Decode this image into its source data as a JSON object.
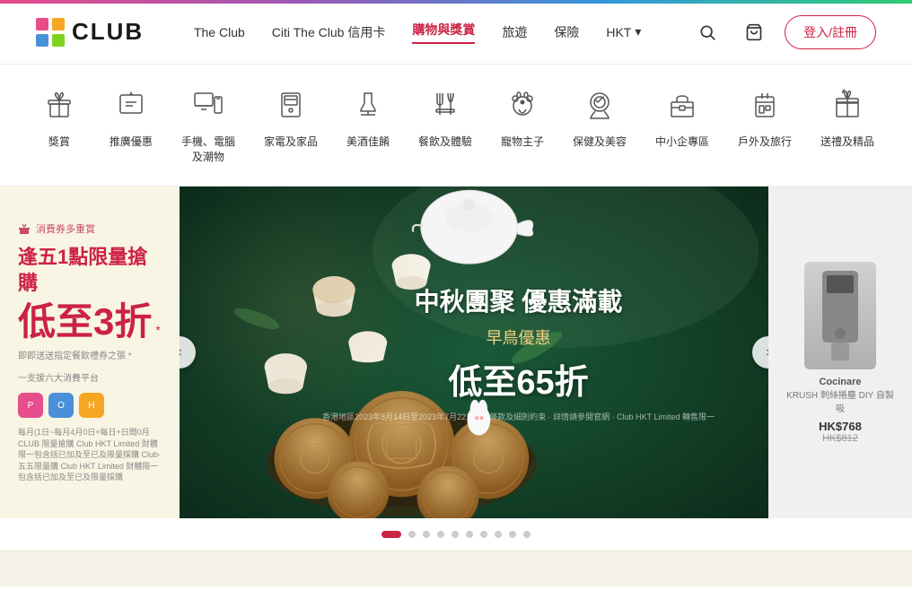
{
  "header": {
    "logo_text": "CLUB",
    "nav_items": [
      {
        "label": "The Club",
        "active": false
      },
      {
        "label": "Citi The Club 信用卡",
        "active": false
      },
      {
        "label": "購物與獎賞",
        "active": true
      },
      {
        "label": "旅遊",
        "active": false
      },
      {
        "label": "保險",
        "active": false
      },
      {
        "label": "HKT",
        "active": false,
        "has_dropdown": true
      }
    ],
    "login_label": "登入/註冊"
  },
  "categories": [
    {
      "id": "rewards",
      "label": "獎賞",
      "icon": "gift"
    },
    {
      "id": "promo",
      "label": "推廣優惠",
      "icon": "tag-star"
    },
    {
      "id": "tech",
      "label": "手機、電腦及潮物",
      "icon": "monitor-phone"
    },
    {
      "id": "home",
      "label": "家電及家品",
      "icon": "fridge"
    },
    {
      "id": "wine",
      "label": "美酒佳餚",
      "icon": "wine"
    },
    {
      "id": "dining",
      "label": "餐飲及體驗",
      "icon": "fork-knife"
    },
    {
      "id": "pet",
      "label": "寵物主子",
      "icon": "pet"
    },
    {
      "id": "health",
      "label": "保健及美容",
      "icon": "heart-face"
    },
    {
      "id": "sme",
      "label": "中小企專區",
      "icon": "briefcase"
    },
    {
      "id": "travel",
      "label": "戶外及旅行",
      "icon": "luggage"
    },
    {
      "id": "gifts",
      "label": "送禮及精品",
      "icon": "gift-box"
    }
  ],
  "banner": {
    "left": {
      "badge": "消費券多重賞",
      "title_line1": "逢五1點限量搶購",
      "promo_text": "低至3折",
      "promo_suffix": "*",
      "note": "即即送送指定餐飲禮券之張 *",
      "sub_note": "一支援六大消費平台",
      "desc": "每月(1日~每月4月0日+每日+日間0月CLUB 限量搶購 Club HKT Limited 財體限一包含括已加及至已及限量採購 Club-五五限量購 Club HKT Limited 財體限一包含括已加及至已及限量採購"
    },
    "main": {
      "title": "中秋團聚 優惠滿載",
      "subtitle": "早鳥優惠",
      "discount": "低至65折"
    },
    "right": {
      "brand": "Cocinare",
      "product_name": "KRUSH 刺絲捲塵 DIY 自製吸",
      "price": "HK$768",
      "orig_price": "HK$812"
    }
  },
  "carousel": {
    "dots_count": 10,
    "active_dot": 0
  }
}
